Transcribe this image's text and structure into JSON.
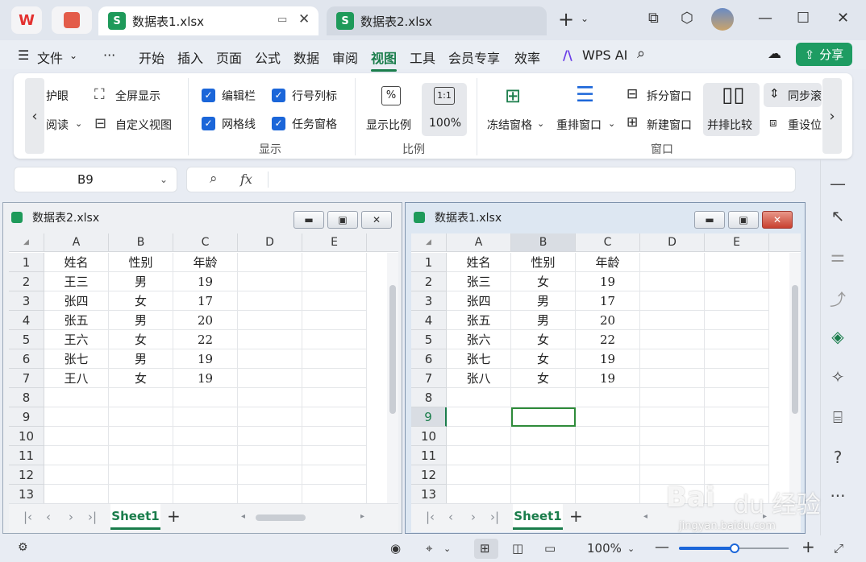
{
  "tabs": [
    {
      "icon": "S",
      "label": "数据表1.xlsx",
      "active": true
    },
    {
      "icon": "S",
      "label": "数据表2.xlsx",
      "active": false
    }
  ],
  "menu": {
    "file": "文件",
    "more": "···",
    "items": [
      "开始",
      "插入",
      "页面",
      "公式",
      "数据",
      "审阅",
      "视图",
      "工具",
      "会员专享",
      "效率"
    ],
    "active": "视图",
    "ai": "WPS AI",
    "share": "分享"
  },
  "ribbon": {
    "protect": "护眼",
    "read": "阅读",
    "fullscreen": "全屏显示",
    "custom_view": "自定义视图",
    "checks": [
      "编辑栏",
      "行号列标",
      "网格线",
      "任务窗格"
    ],
    "group_display": "显示",
    "ratio": "显示比例",
    "pct": "100%",
    "ratio_icon": "1:1",
    "group_ratio": "比例",
    "freeze": "冻结窗格",
    "rearrange": "重排窗口",
    "split": "拆分窗口",
    "newwin": "新建窗口",
    "sidebyside": "并排比较",
    "syncscroll": "同步滚",
    "resetpos": "重设位",
    "group_window": "窗口"
  },
  "formula": {
    "namebox": "B9",
    "fx": "fx",
    "content": ""
  },
  "window_left": {
    "title": "数据表2.xlsx",
    "columns": [
      "A",
      "B",
      "C",
      "D",
      "E"
    ],
    "rows": [
      "1",
      "2",
      "3",
      "4",
      "5",
      "6",
      "7",
      "8",
      "9",
      "10",
      "11",
      "12",
      "13"
    ],
    "data": [
      [
        "姓名",
        "性别",
        "年龄"
      ],
      [
        "王三",
        "男",
        "19"
      ],
      [
        "张四",
        "女",
        "17"
      ],
      [
        "张五",
        "男",
        "20"
      ],
      [
        "王六",
        "女",
        "22"
      ],
      [
        "张七",
        "男",
        "19"
      ],
      [
        "王八",
        "女",
        "19"
      ]
    ],
    "sheet": "Sheet1"
  },
  "window_right": {
    "title": "数据表1.xlsx",
    "columns": [
      "A",
      "B",
      "C",
      "D",
      "E"
    ],
    "rows": [
      "1",
      "2",
      "3",
      "4",
      "5",
      "6",
      "7",
      "8",
      "9",
      "10",
      "11",
      "12",
      "13"
    ],
    "data": [
      [
        "姓名",
        "性别",
        "年龄"
      ],
      [
        "张三",
        "女",
        "19"
      ],
      [
        "张四",
        "男",
        "17"
      ],
      [
        "张五",
        "男",
        "20"
      ],
      [
        "张六",
        "女",
        "22"
      ],
      [
        "张七",
        "女",
        "19"
      ],
      [
        "张八",
        "女",
        "19"
      ]
    ],
    "sheet": "Sheet1"
  },
  "status": {
    "zoom": "100%"
  },
  "watermark": "Baidu 经验 jingyan.baidu.com"
}
